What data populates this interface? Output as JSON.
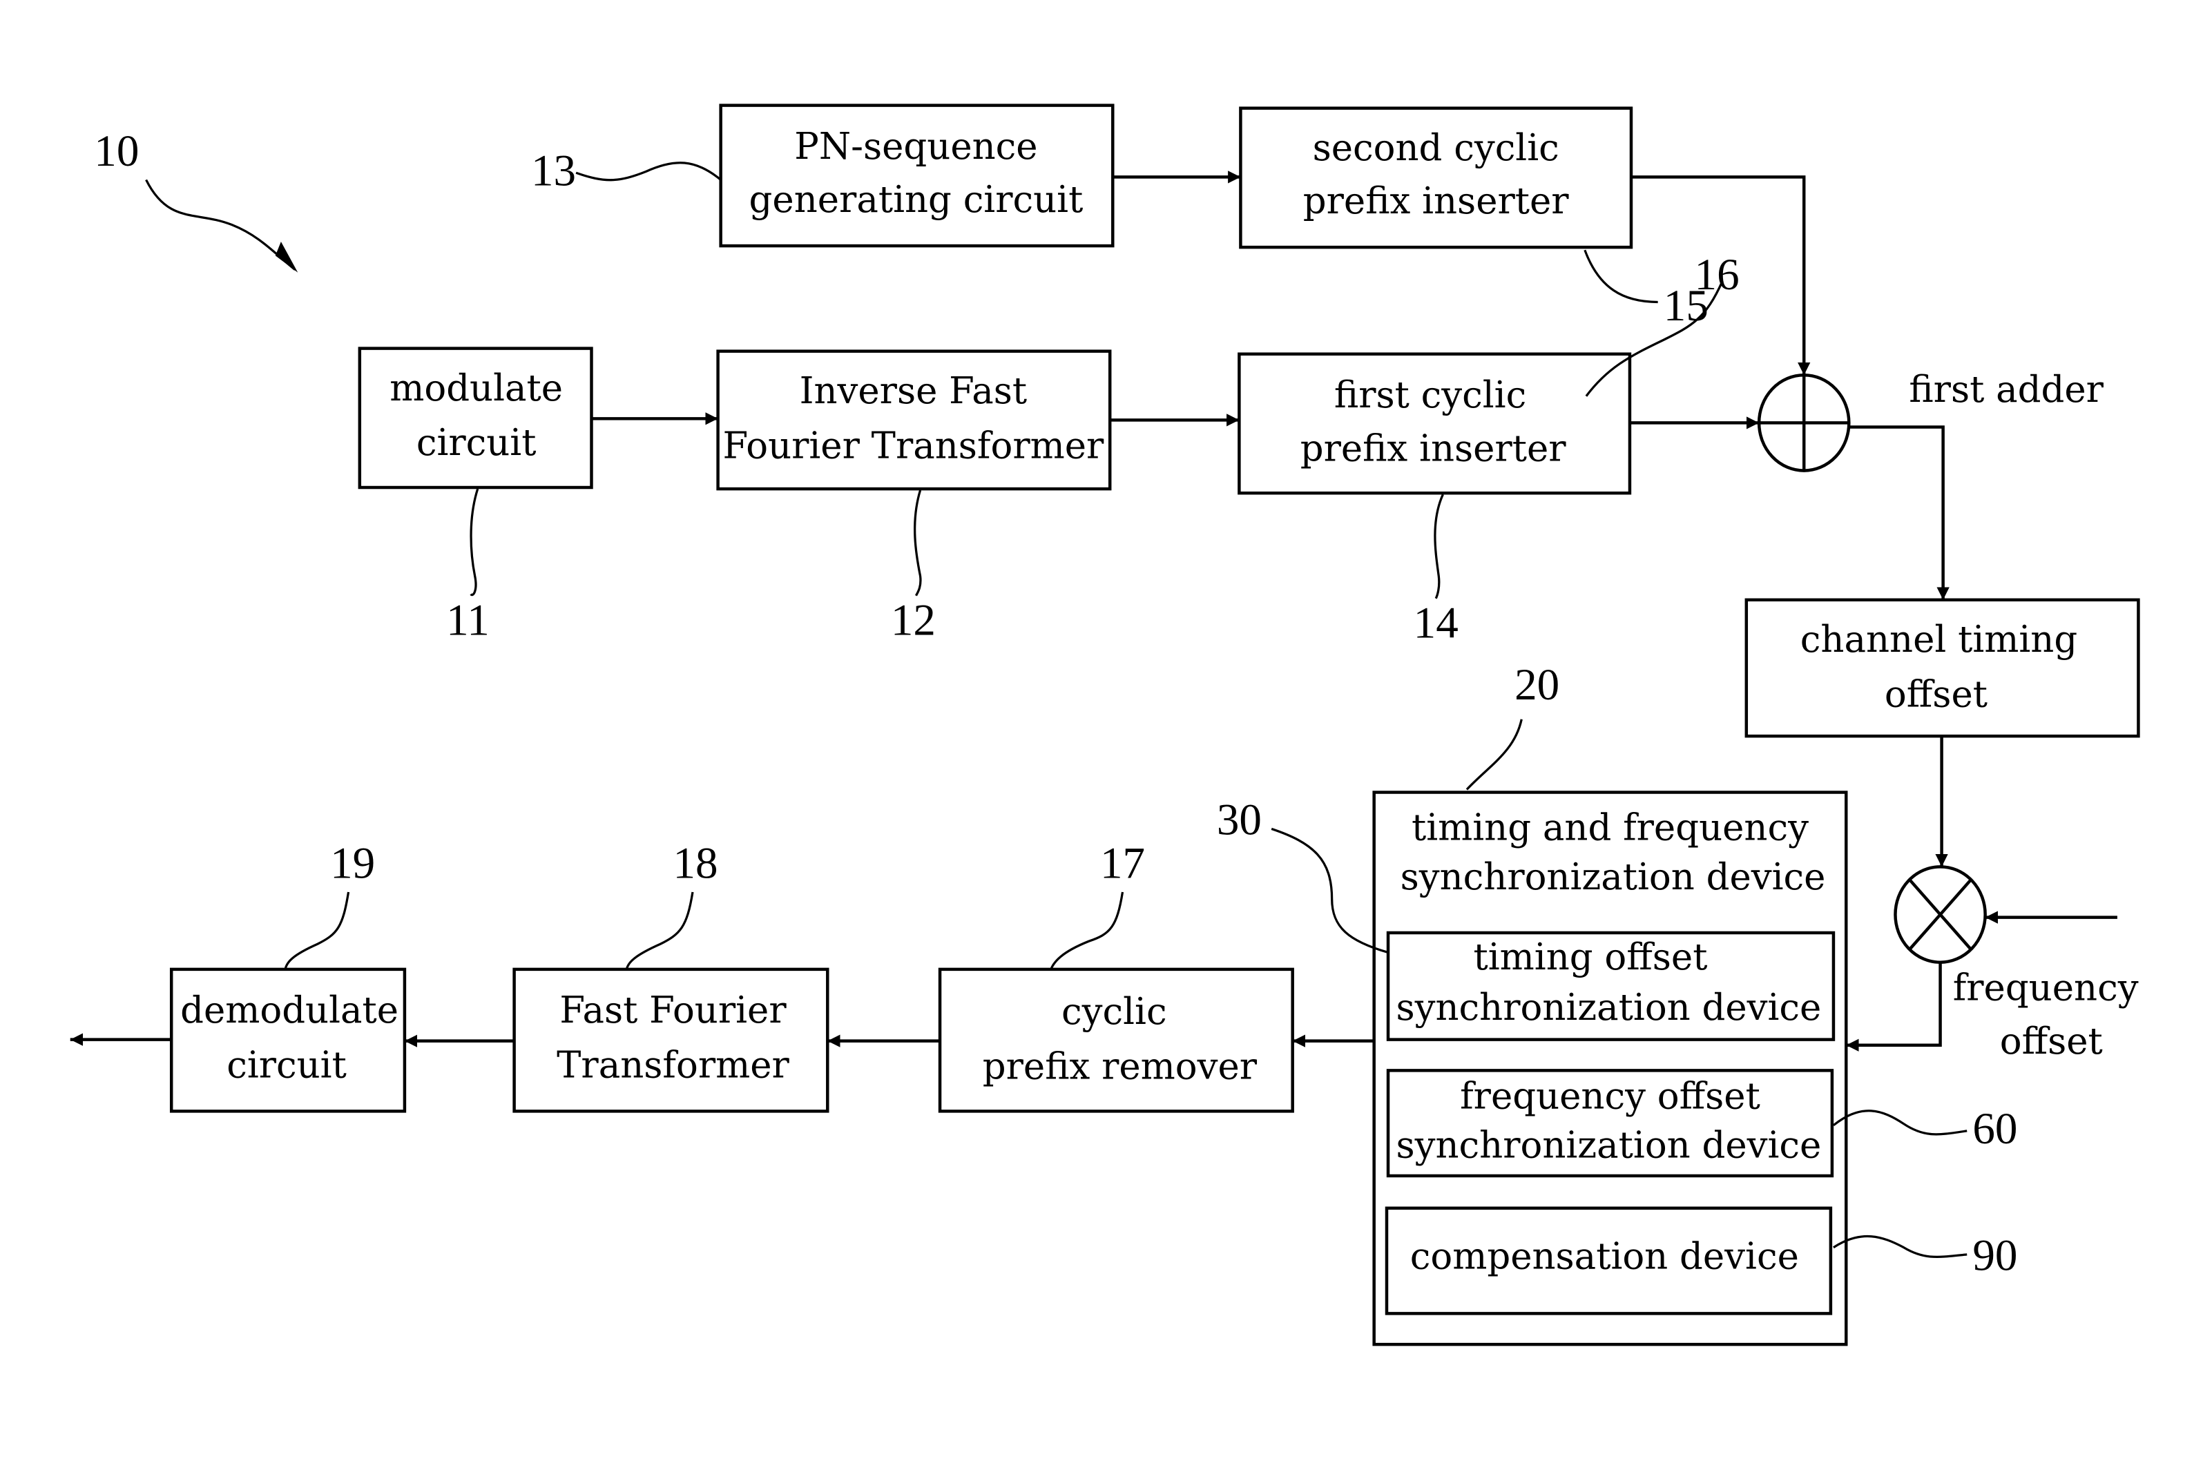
{
  "figure_ref": "10",
  "blocks": {
    "pn_sequence": {
      "ref": "13",
      "lines": [
        "PN-sequence",
        "generating circuit"
      ]
    },
    "second_cp": {
      "ref": "15",
      "lines": [
        "second cyclic",
        "prefix inserter"
      ]
    },
    "modulate": {
      "ref": "11",
      "lines": [
        "modulate",
        "circuit"
      ]
    },
    "ifft": {
      "ref": "12",
      "lines": [
        "Inverse Fast",
        "Fourier Transformer"
      ]
    },
    "first_cp": {
      "ref": "14",
      "lines": [
        "first cyclic",
        "prefix inserter"
      ]
    },
    "adder": {
      "ref": "16",
      "label": "first adder"
    },
    "channel": {
      "lines": [
        "channel timing",
        "offset"
      ]
    },
    "mixer": {
      "lines": [
        "frequency",
        "offset"
      ]
    },
    "sync_device": {
      "ref": "20",
      "lines": [
        "timing and frequency",
        "synchronization device"
      ]
    },
    "timing_sync": {
      "ref": "30",
      "lines": [
        "timing offset",
        "synchronization device"
      ]
    },
    "freq_sync": {
      "ref": "60",
      "lines": [
        "frequency offset",
        "synchronization device"
      ]
    },
    "compensation": {
      "ref": "90",
      "lines": [
        "compensation device"
      ]
    },
    "cp_remover": {
      "ref": "17",
      "lines": [
        "cyclic",
        "prefix remover"
      ]
    },
    "fft": {
      "ref": "18",
      "lines": [
        "Fast Fourier",
        "Transformer"
      ]
    },
    "demodulate": {
      "ref": "19",
      "lines": [
        "demodulate",
        "circuit"
      ]
    }
  }
}
